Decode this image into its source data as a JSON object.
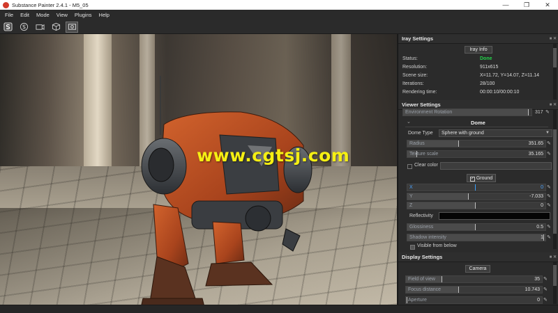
{
  "window": {
    "title": "Substance Painter 2.4.1 - M5_05",
    "controls": {
      "minimize": "—",
      "maximize": "❐",
      "close": "✕"
    }
  },
  "menu": [
    "File",
    "Edit",
    "Mode",
    "View",
    "Plugins",
    "Help"
  ],
  "viewport": {
    "watermark": "www.cgtsj.com",
    "watermark_color": "#f5ef13"
  },
  "iray": {
    "header": "Iray Settings",
    "info_button": "Iray Info",
    "rows": [
      {
        "label": "Status:",
        "value": "Done"
      },
      {
        "label": "Resolution:",
        "value": "911x615"
      },
      {
        "label": "Scene size:",
        "value": "X=11.72, Y=14.07, Z=11.14"
      },
      {
        "label": "Iterations:",
        "value": "28/100"
      },
      {
        "label": "Rendering time:",
        "value": "00:00:10/00:00:10"
      }
    ],
    "status_color": "#22d34a"
  },
  "viewer": {
    "header": "Viewer Settings",
    "env_rotation": {
      "label": "Environment Rotation",
      "value": "317"
    },
    "dome": {
      "title": "Dome",
      "type_label": "Dome Type",
      "type_value": "Sphere with ground",
      "radius": {
        "label": "Radius",
        "value": "351.65"
      },
      "texture_scale": {
        "label": "Texture scale",
        "value": "35.165"
      },
      "clear_color": "Clear color"
    },
    "ground": {
      "button": "Ground",
      "x": {
        "label": "X",
        "value": "0"
      },
      "y": {
        "label": "Y",
        "value": "-7.033"
      },
      "z": {
        "label": "Z",
        "value": "0"
      },
      "reflectivity": "Reflectivity",
      "glossiness": {
        "label": "Glossiness",
        "value": "0.5"
      },
      "shadow_intensity": {
        "label": "Shadow intensity",
        "value": "1"
      },
      "visible_from_below": "Visible from below"
    }
  },
  "display": {
    "header": "Display Settings",
    "camera_button": "Camera",
    "fov": {
      "label": "Field of view",
      "value": "35"
    },
    "focus": {
      "label": "Focus distance",
      "value": "10.743"
    },
    "aperture": {
      "label": "Aperture",
      "value": "0"
    }
  }
}
